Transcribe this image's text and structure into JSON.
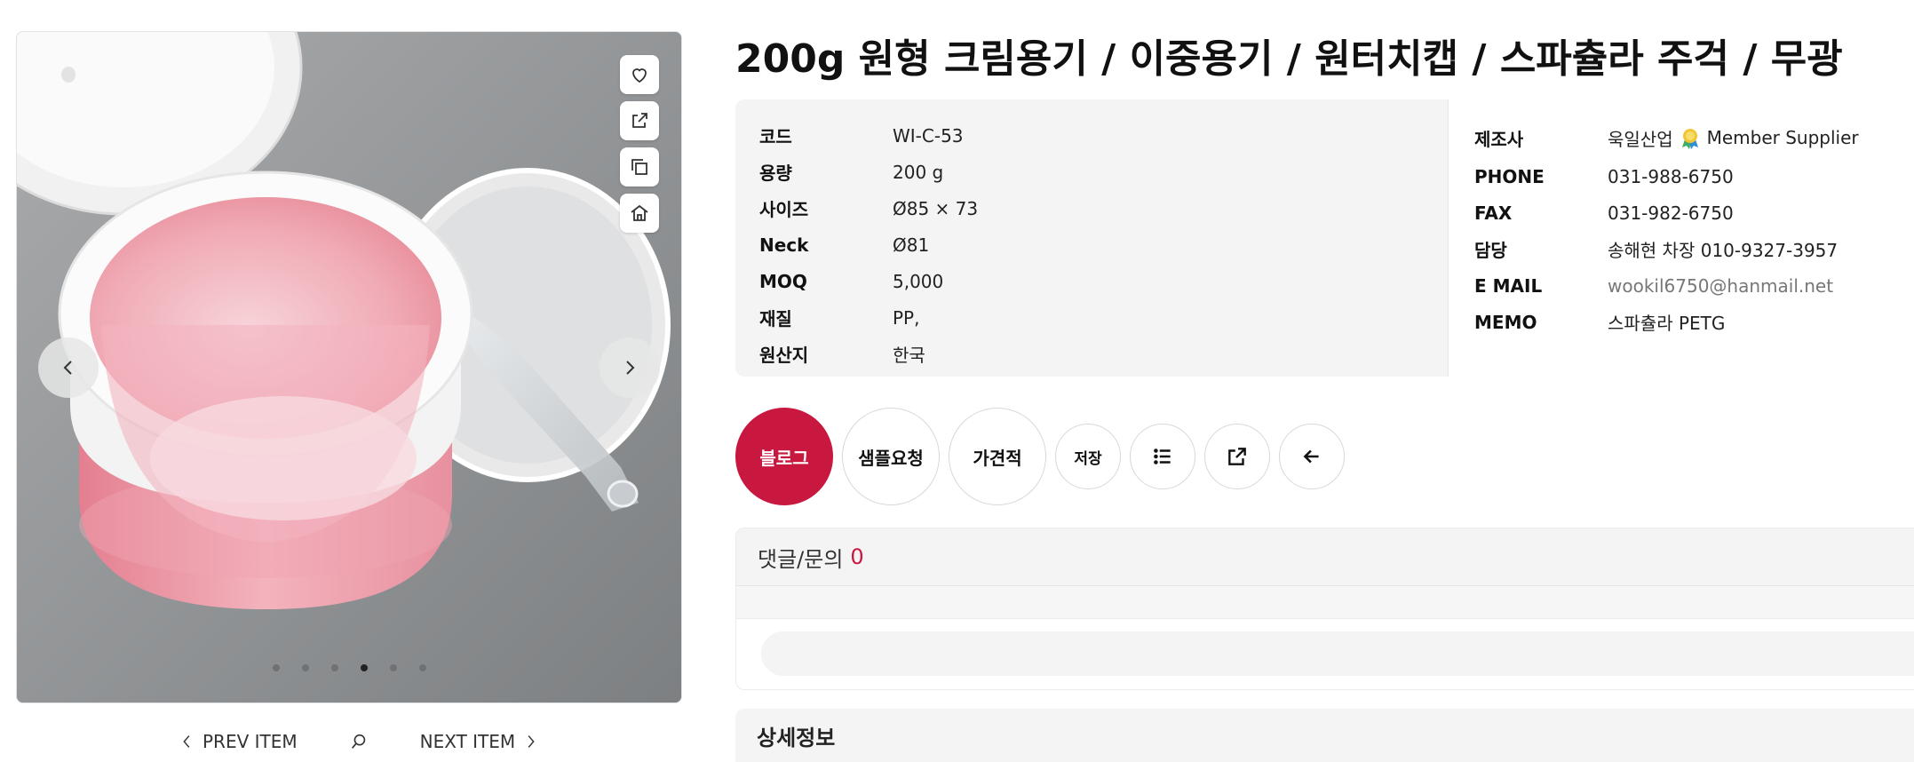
{
  "product": {
    "title": "200g 원형 크림용기 / 이중용기 / 원터치캡 / 스파츌라 주걱 / 무광"
  },
  "gallery": {
    "image_alt": "pink cream jar with white lid and clear spatula",
    "dots": 6,
    "active_dot": 4,
    "tools": [
      "heart-icon",
      "share-icon",
      "copy-icon",
      "home-icon"
    ]
  },
  "item_nav": {
    "prev_label": "PREV ITEM",
    "next_label": "NEXT ITEM"
  },
  "specs": [
    {
      "label": "코드",
      "value": "WI-C-53"
    },
    {
      "label": "용량",
      "value": "200 g"
    },
    {
      "label": "사이즈",
      "value": "Ø85 × 73"
    },
    {
      "label": "Neck",
      "value": "Ø81"
    },
    {
      "label": "MOQ",
      "value": "5,000"
    },
    {
      "label": "재질",
      "value": "PP,"
    },
    {
      "label": "원산지",
      "value": "한국"
    }
  ],
  "supplier": {
    "maker_label": "제조사",
    "maker_value": "욱일산업",
    "badge_text": "Member Supplier",
    "phone_label": "PHONE",
    "phone_value": "031-988-6750",
    "fax_label": "FAX",
    "fax_value": "031-982-6750",
    "contact_label": "담당",
    "contact_value": "송해현 차장 010-9327-3957",
    "email_label": "E MAIL",
    "email_value": "wookil6750@hanmail.net",
    "memo_label": "MEMO",
    "memo_value": "스파츌라 PETG"
  },
  "actions": {
    "blog": "블로그",
    "sample": "샘플요청",
    "quote": "가견적",
    "save": "저장"
  },
  "comments": {
    "title": "댓글/문의",
    "count": "0"
  },
  "detail": {
    "title": "상세정보"
  },
  "colors": {
    "accent": "#c8183f",
    "panel": "#f4f4f4"
  }
}
